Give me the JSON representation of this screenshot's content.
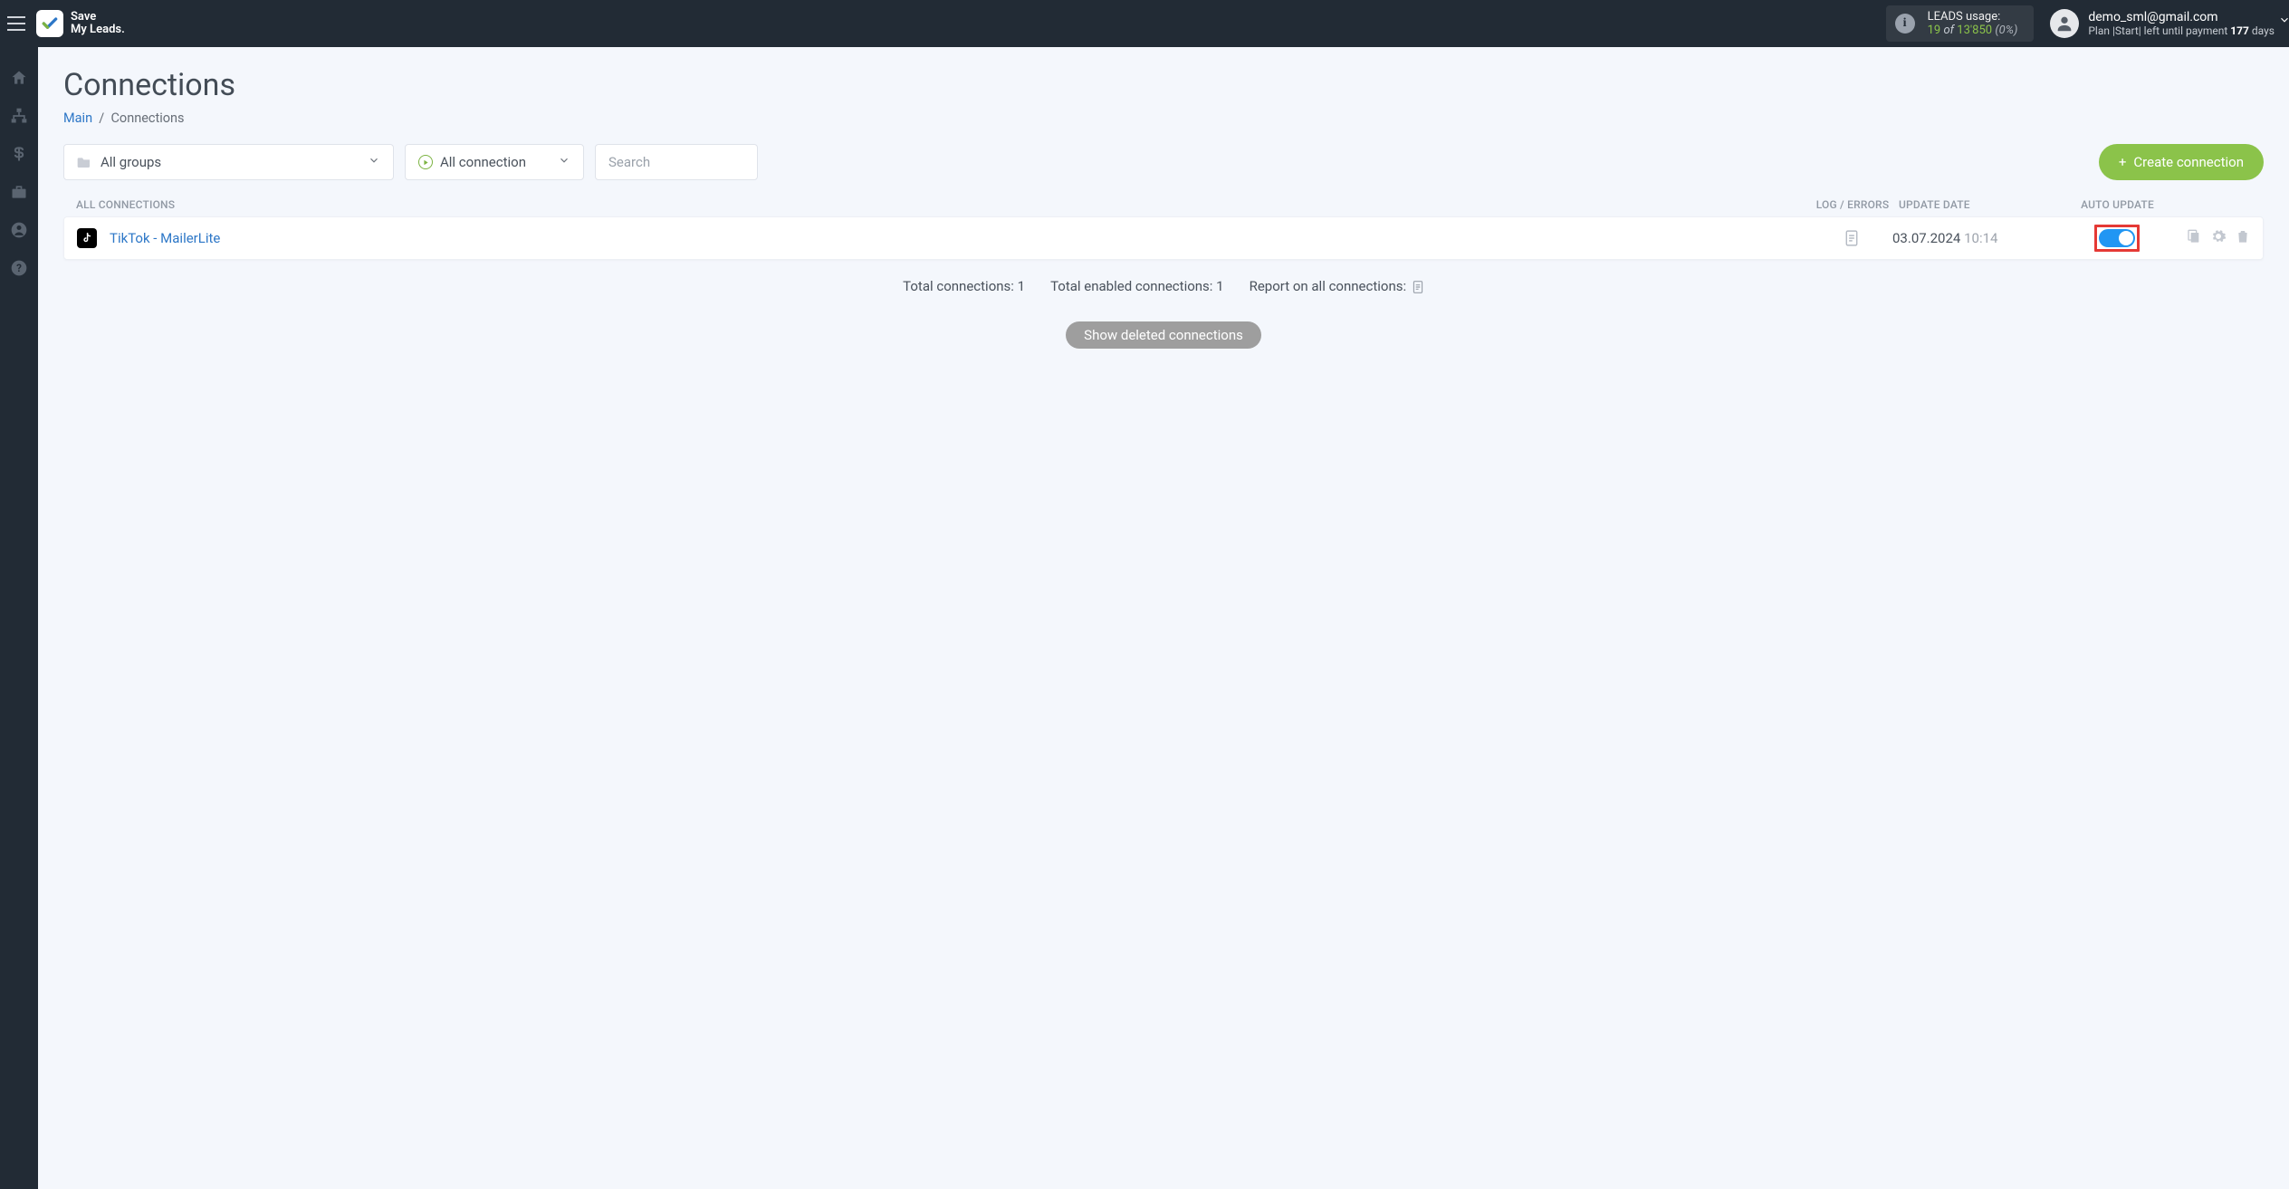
{
  "brand": {
    "line1": "Save",
    "line2": "My Leads."
  },
  "leads": {
    "label": "LEADS usage:",
    "used": "19",
    "of_word": "of",
    "total": "13'850",
    "pct": "(0%)"
  },
  "user": {
    "email": "demo_sml@gmail.com",
    "plan_prefix": "Plan |Start| left until payment ",
    "days": "177",
    "days_suffix": " days"
  },
  "page": {
    "title": "Connections"
  },
  "breadcrumb": {
    "main": "Main",
    "sep": "/",
    "current": "Connections"
  },
  "filters": {
    "groups": "All groups",
    "connection": "All connection",
    "search_placeholder": "Search"
  },
  "create_btn": "Create connection",
  "headers": {
    "all": "All connections",
    "log": "Log / Errors",
    "update": "Update date",
    "auto": "Auto update"
  },
  "rows": [
    {
      "name": "TikTok - MailerLite",
      "date": "03.07.2024",
      "time": "10:14"
    }
  ],
  "summary": {
    "total": "Total connections: 1",
    "enabled": "Total enabled connections: 1",
    "report": "Report on all connections:"
  },
  "show_deleted": "Show deleted connections"
}
